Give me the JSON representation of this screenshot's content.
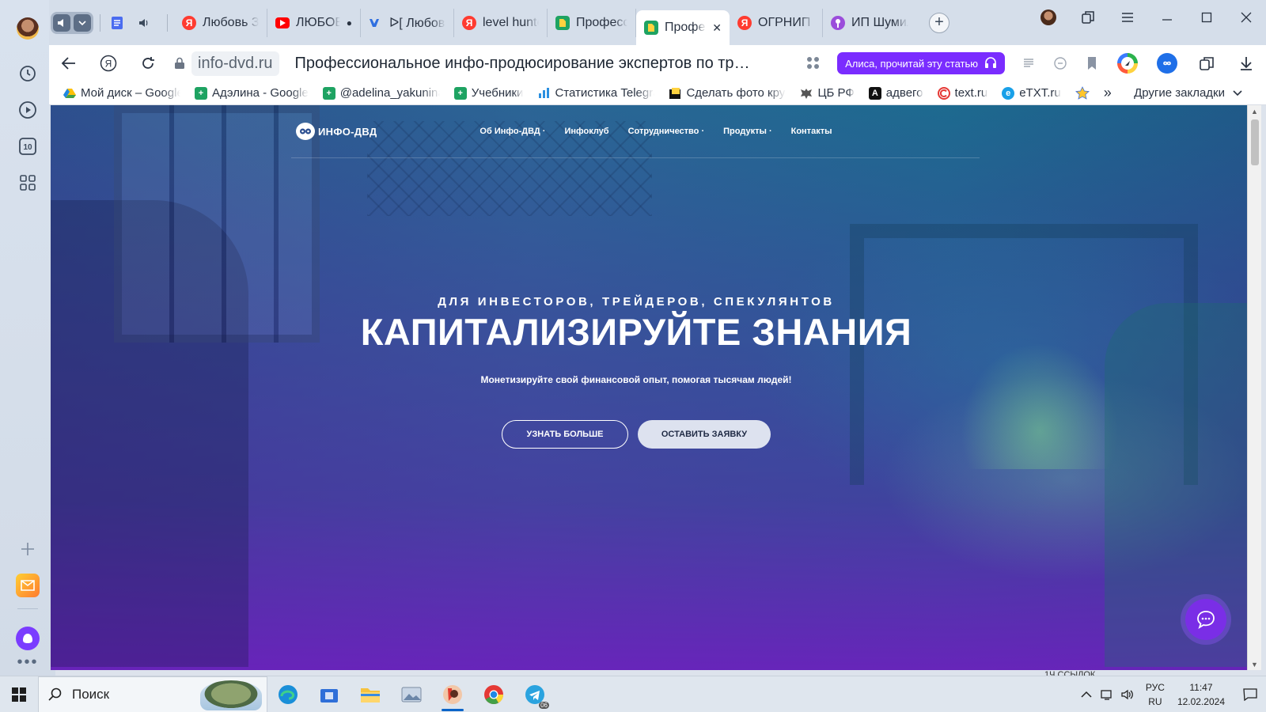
{
  "browser": {
    "tabs": [
      {
        "label": "Любовь З",
        "favicon": "yandex",
        "active": false
      },
      {
        "label": "ЛЮБОВЬ",
        "favicon": "youtube",
        "active": false,
        "playing_dot": "●"
      },
      {
        "label": "ᐅ[ Любовь",
        "favicon": "vk",
        "active": false
      },
      {
        "label": "level hunter",
        "favicon": "yandex",
        "active": false
      },
      {
        "label": "Профессиона",
        "favicon": "green-doc",
        "active": false
      },
      {
        "label": "Профессиона",
        "favicon": "green-doc",
        "active": true,
        "close": "✕"
      },
      {
        "label": "ОГРНИП З",
        "favicon": "yandex",
        "active": false
      },
      {
        "label": "ИП Шумил",
        "favicon": "podcast",
        "active": false
      }
    ],
    "new_tab": "+",
    "address": {
      "domain": "info-dvd.ru",
      "title": "Профессиональное инфо-продюсирование экспертов по трейди...",
      "alice_button": "Алиса, прочитай эту статью"
    },
    "bookmarks": [
      {
        "label": "Мой диск – Google",
        "favicon": "gdrive"
      },
      {
        "label": "Адэлина - Google",
        "favicon": "gsheets"
      },
      {
        "label": "@adelina_yakunina",
        "favicon": "gsheets"
      },
      {
        "label": "Учебники",
        "favicon": "gsheets"
      },
      {
        "label": "Статистика Telegram",
        "favicon": "tgstat"
      },
      {
        "label": "Сделать фото круглым",
        "favicon": "photo"
      },
      {
        "label": "ЦБ РФ",
        "favicon": "cbr"
      },
      {
        "label": "адвего",
        "favicon": "advego"
      },
      {
        "label": "text.ru",
        "favicon": "textru"
      },
      {
        "label": "eTXT.ru",
        "favicon": "etxt"
      }
    ],
    "bookmarks_more": "»",
    "other_bookmarks": "Другие закладки",
    "sidebar_badge": "10"
  },
  "site": {
    "logo": "ИНФО-ДВД",
    "menu": [
      {
        "label": "Об Инфо-ДВД",
        "has_dropdown": true
      },
      {
        "label": "Инфоклуб",
        "has_dropdown": false
      },
      {
        "label": "Сотрудничество",
        "has_dropdown": true
      },
      {
        "label": "Продукты",
        "has_dropdown": true
      },
      {
        "label": "Контакты",
        "has_dropdown": false
      }
    ],
    "dropdown_marker": "·",
    "hero": {
      "kicker": "ДЛЯ ИНВЕСТОРОВ, ТРЕЙДЕРОВ, СПЕКУЛЯНТОВ",
      "title": "КАПИТАЛИЗИРУЙТЕ ЗНАНИЯ",
      "subtitle": "Монетизируйте свой финансовой опыт, помогая тысячам людей!",
      "btn_more": "УЗНАТЬ БОЛЬШЕ",
      "btn_apply": "ОСТАВИТЬ ЗАЯВКУ"
    },
    "peek_text": "1Ч ССЫЛОК"
  },
  "taskbar": {
    "search_placeholder": "Поиск",
    "lang_top": "РУС",
    "lang_bottom": "RU",
    "time": "11:47",
    "date": "12.02.2024",
    "telegram_badge": "06"
  },
  "colors": {
    "accent": "#7a2cff",
    "active_tab": "#ffffff",
    "tabstrip": "#d5deea"
  }
}
